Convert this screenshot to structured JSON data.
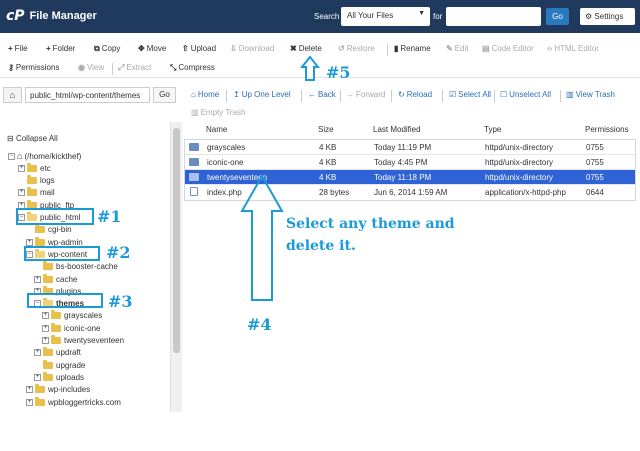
{
  "app": {
    "logo": "cP",
    "title": "File Manager"
  },
  "search": {
    "label": "Search",
    "scope": "All Your Files",
    "for_label": "for",
    "query": "",
    "go_label": "Go",
    "settings_label": "Settings"
  },
  "toolbar": {
    "row1": [
      {
        "icon": "plus-icon",
        "glyph": "+",
        "label": "File",
        "enabled": true
      },
      {
        "icon": "plus-icon",
        "glyph": "+",
        "label": "Folder",
        "enabled": true
      },
      {
        "icon": "copy-icon",
        "glyph": "⧉",
        "label": "Copy",
        "enabled": true
      },
      {
        "icon": "move-icon",
        "glyph": "✥",
        "label": "Move",
        "enabled": true
      },
      {
        "icon": "upload-icon",
        "glyph": "⇧",
        "label": "Upload",
        "enabled": true
      },
      {
        "icon": "download-icon",
        "glyph": "⇩",
        "label": "Download",
        "enabled": false
      },
      {
        "icon": "delete-icon",
        "glyph": "✖",
        "label": "Delete",
        "enabled": true
      },
      {
        "icon": "restore-icon",
        "glyph": "↺",
        "label": "Restore",
        "enabled": false
      },
      {
        "icon": "rename-icon",
        "glyph": "▮",
        "label": "Rename",
        "enabled": true
      },
      {
        "icon": "edit-icon",
        "glyph": "✎",
        "label": "Edit",
        "enabled": false
      },
      {
        "icon": "code-editor-icon",
        "glyph": "▤",
        "label": "Code Editor",
        "enabled": false
      },
      {
        "icon": "html-editor-icon",
        "glyph": "‹›",
        "label": "HTML Editor",
        "enabled": false
      }
    ],
    "row2": [
      {
        "icon": "key-icon",
        "glyph": "⚷",
        "label": "Permissions",
        "enabled": true
      },
      {
        "icon": "eye-icon",
        "glyph": "◉",
        "label": "View",
        "enabled": false
      },
      {
        "icon": "extract-icon",
        "glyph": "⤢",
        "label": "Extract",
        "enabled": false
      },
      {
        "icon": "compress-icon",
        "glyph": "⤡",
        "label": "Compress",
        "enabled": true
      }
    ]
  },
  "path": {
    "home_glyph": "⌂",
    "value": "public_html/wp-content/themes",
    "go_label": "Go"
  },
  "nav": [
    {
      "icon": "home-icon",
      "glyph": "⌂",
      "label": "Home",
      "enabled": true
    },
    {
      "icon": "up-icon",
      "glyph": "↥",
      "label": "Up One Level",
      "enabled": true
    },
    {
      "icon": "back-icon",
      "glyph": "←",
      "label": "Back",
      "enabled": true
    },
    {
      "icon": "forward-icon",
      "glyph": "→",
      "label": "Forward",
      "enabled": false
    },
    {
      "icon": "reload-icon",
      "glyph": "↻",
      "label": "Reload",
      "enabled": true
    },
    {
      "icon": "select-all-icon",
      "glyph": "☑",
      "label": "Select All",
      "enabled": true
    },
    {
      "icon": "unselect-all-icon",
      "glyph": "☐",
      "label": "Unselect All",
      "enabled": true
    },
    {
      "icon": "trash-icon",
      "glyph": "▥",
      "label": "View Trash",
      "enabled": true
    },
    {
      "icon": "trash-icon",
      "glyph": "▥",
      "label": "Empty Trash",
      "enabled": false
    }
  ],
  "sidebar": {
    "collapse_label": "Collapse All",
    "tree": [
      {
        "label": "(/home/kickthef)",
        "toggle": "−",
        "open": true,
        "home": true
      },
      {
        "label": "etc",
        "toggle": "+"
      },
      {
        "label": "logs",
        "toggle": ""
      },
      {
        "label": "mail",
        "toggle": "+"
      },
      {
        "label": "public_ftp",
        "toggle": "+"
      },
      {
        "label": "public_html",
        "toggle": "−",
        "open": true
      },
      {
        "label": "cgi-bin",
        "toggle": ""
      },
      {
        "label": "wp-admin",
        "toggle": "+"
      },
      {
        "label": "wp-content",
        "toggle": "−",
        "open": true
      },
      {
        "label": "bs-booster-cache",
        "toggle": ""
      },
      {
        "label": "cache",
        "toggle": "+"
      },
      {
        "label": "plugins",
        "toggle": "+"
      },
      {
        "label": "themes",
        "toggle": "−",
        "open": true,
        "bold": true
      },
      {
        "label": "grayscales",
        "toggle": "+"
      },
      {
        "label": "iconic-one",
        "toggle": "+"
      },
      {
        "label": "twentyseventeen",
        "toggle": "+"
      },
      {
        "label": "updraft",
        "toggle": "+"
      },
      {
        "label": "upgrade",
        "toggle": ""
      },
      {
        "label": "uploads",
        "toggle": "+"
      },
      {
        "label": "wp-includes",
        "toggle": "+"
      },
      {
        "label": "wpbloggertricks.com",
        "toggle": "+"
      }
    ]
  },
  "files": {
    "columns": [
      "Name",
      "Size",
      "Last Modified",
      "Type",
      "Permissions"
    ],
    "rows": [
      {
        "name": "grayscales",
        "size": "4 KB",
        "modified": "Today 11:19 PM",
        "type": "httpd/unix-directory",
        "perms": "0755",
        "kind": "folder",
        "selected": false
      },
      {
        "name": "iconic-one",
        "size": "4 KB",
        "modified": "Today 4:45 PM",
        "type": "httpd/unix-directory",
        "perms": "0755",
        "kind": "folder",
        "selected": false
      },
      {
        "name": "twentyseventeen",
        "size": "4 KB",
        "modified": "Today 11:18 PM",
        "type": "httpd/unix-directory",
        "perms": "0755",
        "kind": "folder",
        "selected": true
      },
      {
        "name": "index.php",
        "size": "28 bytes",
        "modified": "Jun 6, 2014 1:59 AM",
        "type": "application/x-httpd-php",
        "perms": "0644",
        "kind": "php",
        "selected": false
      }
    ]
  },
  "annotations": {
    "n1": "#1",
    "n2": "#2",
    "n3": "#3",
    "n4": "#4",
    "n5": "#5",
    "instruction_line1": "Select any theme and",
    "instruction_line2": "delete it.",
    "color": "#1a9ad6"
  }
}
